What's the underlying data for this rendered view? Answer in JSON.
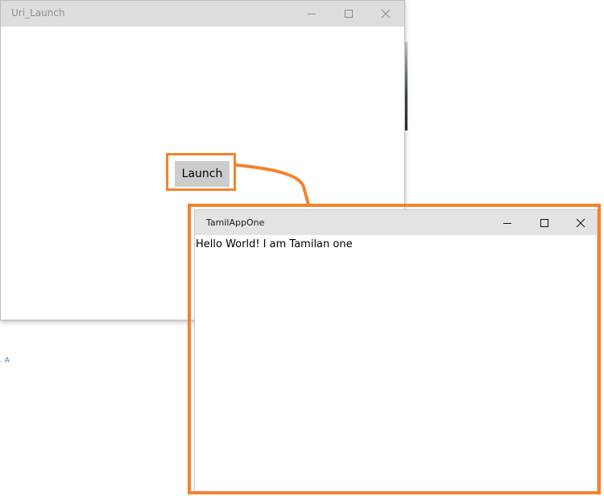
{
  "background": {
    "mark_text": ". A"
  },
  "uri_launch_window": {
    "title": "Uri_Launch",
    "launch_button_label": "Launch"
  },
  "tamil_app_window": {
    "title": "TamilAppOne",
    "message": "Hello World! I am Tamilan one"
  },
  "caption_icons": [
    "minimize-icon",
    "maximize-icon",
    "close-icon"
  ],
  "colors": {
    "highlight": "#f5822b",
    "titlebar_inactive": "#dddddd",
    "titlebar_active": "#e3e3e3",
    "button_face": "#cccccc"
  }
}
